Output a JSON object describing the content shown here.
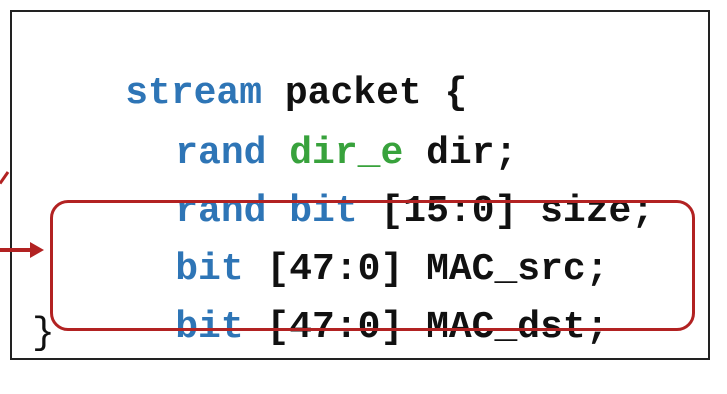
{
  "code": {
    "line1": {
      "kw": "stream",
      "rest": " packet {"
    },
    "line2": {
      "kw": "rand",
      "type": "dir_e",
      "rest": " dir;"
    },
    "line3": {
      "kw": "rand",
      "kw2": "bit",
      "rest": " [15:0] size;"
    },
    "line4": {
      "kw": "bit",
      "rest": " [47:0] MAC_src;"
    },
    "line5": {
      "kw": "bit",
      "rest": " [47:0] MAC_dst;"
    },
    "line6": {
      "text": "}"
    }
  },
  "colors": {
    "keyword": "#2e75b6",
    "type": "#38a23c",
    "text": "#111111",
    "highlight": "#b22222",
    "border": "#222222"
  }
}
